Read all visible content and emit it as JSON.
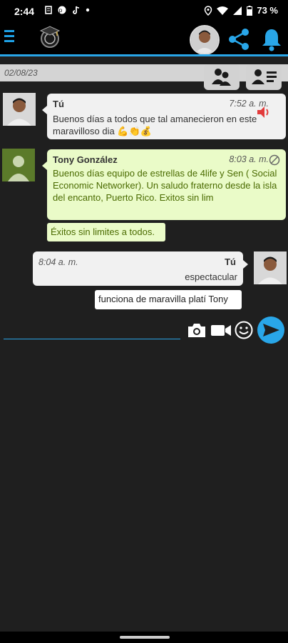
{
  "status_bar": {
    "time": "2:44",
    "battery": "73 %",
    "icons_left": [
      "notification-icon",
      "pinterest-icon",
      "tiktok-icon",
      "dot-icon"
    ],
    "icons_right": [
      "location-icon",
      "wifi-icon",
      "signal-icon",
      "battery-icon"
    ]
  },
  "app_bar": {
    "icons": [
      "menu-icon",
      "graduation-logo",
      "profile-avatar",
      "share-icon",
      "bell-icon"
    ],
    "accent_color": "#29a6e8"
  },
  "date_bar": {
    "date": "02/08/23"
  },
  "messages": [
    {
      "sender": "Tú",
      "time": "7:52 a. m.",
      "text": "Buenos días a todos que tal amanecieron en este maravilloso dia 💪👏💰"
    },
    {
      "sender": "Tony González",
      "time": "8:03 a. m.",
      "text": "Buenos días equipo de estrellas de 4life y Sen ( Social Economic Networker). Un saludo fraterno desde la isla del encanto, Puerto Rico. Exitos sin lim",
      "reply": "Éxitos sin limites a todos."
    },
    {
      "sender": "Tú",
      "time": "8:04 a. m.",
      "text": "espectacular",
      "reply": "funciona de maravilla platí Tony"
    }
  ],
  "composer": {
    "placeholder": "",
    "icons": [
      "camera-icon",
      "video-icon",
      "emoji-icon",
      "send-icon"
    ]
  },
  "colors": {
    "bubble_white": "#f1f1f1",
    "bubble_green": "#eafbc8",
    "background": "#1f1f1f"
  }
}
